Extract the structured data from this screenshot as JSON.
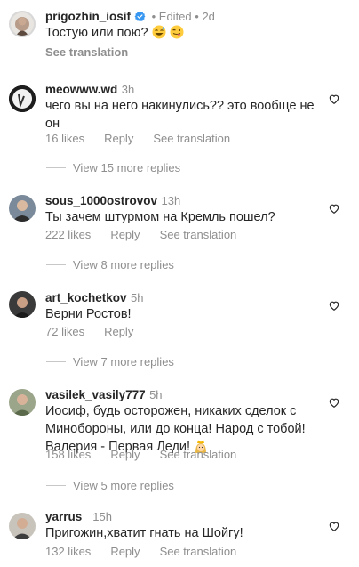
{
  "caption": {
    "username": "prigozhin_iosif",
    "status": "Edited",
    "time": "2d",
    "text": "Тостую или пою?",
    "see_translation": "See translation"
  },
  "comments": [
    {
      "username": "meowww.wd",
      "time": "3h",
      "text_lines": [
        "чего вы на него накинулись?? это вообще не",
        "он"
      ],
      "likes": "16 likes",
      "reply": "Reply",
      "see_translation": "See translation",
      "view_replies": "View 15 more replies"
    },
    {
      "username": "sous_1000ostrovov",
      "time": "13h",
      "text_lines": [
        "Ты зачем штурмом на Кремль пошел?"
      ],
      "likes": "222 likes",
      "reply": "Reply",
      "see_translation": "See translation",
      "view_replies": "View 8 more replies"
    },
    {
      "username": "art_kochetkov",
      "time": "5h",
      "text_lines": [
        "Верни Ростов!"
      ],
      "likes": "72 likes",
      "reply": "Reply",
      "view_replies": "View 7 more replies"
    },
    {
      "username": "vasilek_vasily777",
      "time": "5h",
      "text_lines": [
        "Иосиф, будь осторожен, никаких сделок с",
        "Минобороны, или до конца! Народ с тобой!",
        "Валерия - Первая Леди!"
      ],
      "likes": "158 likes",
      "reply": "Reply",
      "see_translation": "See translation",
      "view_replies": "View 5 more replies"
    },
    {
      "username": "yarrus_",
      "time": "15h",
      "text_lines": [
        "Пригожин,хватит гнать на Шойгу!"
      ],
      "likes": "132 likes",
      "reply": "Reply",
      "see_translation": "See translation"
    }
  ],
  "colors": {
    "text": "#262626",
    "secondary": "#8e8e8e",
    "verified": "#3897f0",
    "divider": "#dbdbdb"
  },
  "icons": [
    "verified-badge-icon",
    "grinning-sweat-emoji",
    "winking-tongue-emoji",
    "heart-icon",
    "crowned-princess-emoji"
  ]
}
